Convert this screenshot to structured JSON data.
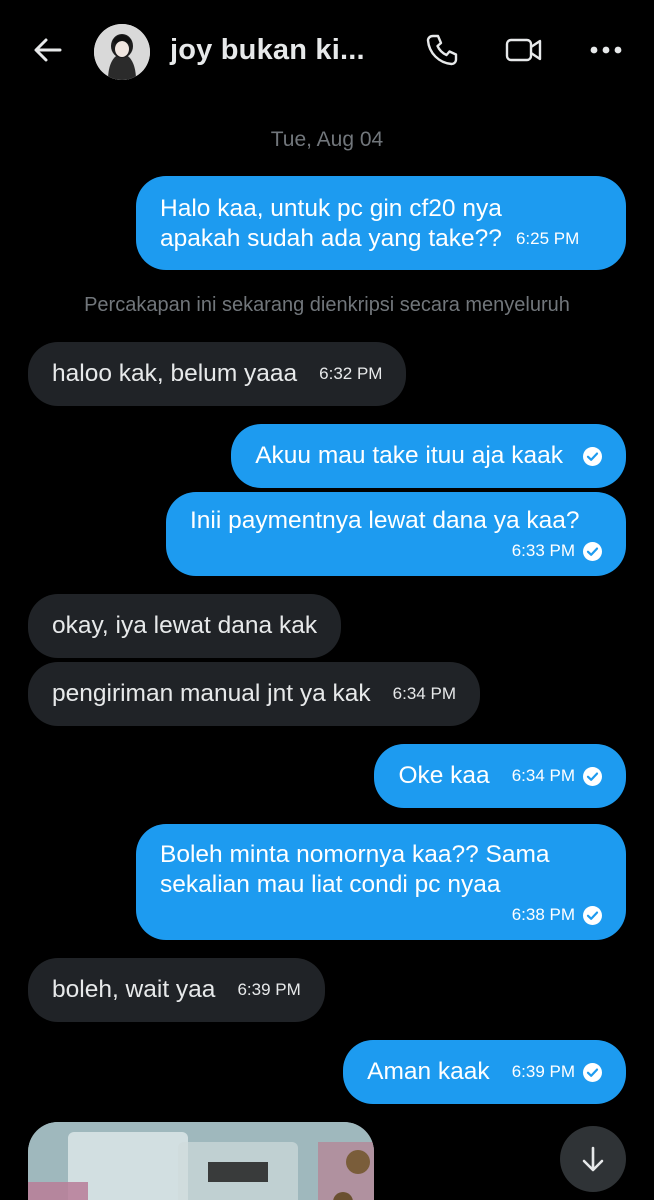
{
  "header": {
    "contact_name": "joy bukan ki...",
    "icons": [
      "back-arrow-icon",
      "phone-icon",
      "video-camera-icon",
      "more-icon"
    ]
  },
  "chat": {
    "date_separator": "Tue, Aug 04",
    "encryption_notice": "Percakapan ini sekarang dienkripsi secara menyeluruh",
    "messages": [
      {
        "line1": "Halo kaa, untuk pc gin cf20 nya",
        "line2": "apakah sudah ada yang take??",
        "time": "6:25 PM"
      },
      {
        "text": "haloo kak, belum yaaa",
        "time": "6:32 PM"
      },
      {
        "text": "Akuu mau take ituu aja kaak"
      },
      {
        "text": "Inii paymentnya lewat dana ya kaa?",
        "time": "6:33 PM"
      },
      {
        "text": "okay, iya lewat dana kak"
      },
      {
        "text": "pengiriman manual jnt ya kak",
        "time": "6:34 PM"
      },
      {
        "text": "Oke kaa",
        "time": "6:34 PM"
      },
      {
        "line1": "Boleh minta nomornya kaa?? Sama",
        "line2": "sekalian mau liat condi pc nyaa",
        "time": "6:38 PM"
      },
      {
        "text": "boleh, wait yaa",
        "time": "6:39 PM"
      },
      {
        "text": "Aman kaak",
        "time": "6:39 PM"
      }
    ]
  },
  "colors": {
    "background": "#000000",
    "outgoing_bubble": "#1d9bf0",
    "incoming_bubble": "#202327",
    "muted_text": "#71767b"
  }
}
